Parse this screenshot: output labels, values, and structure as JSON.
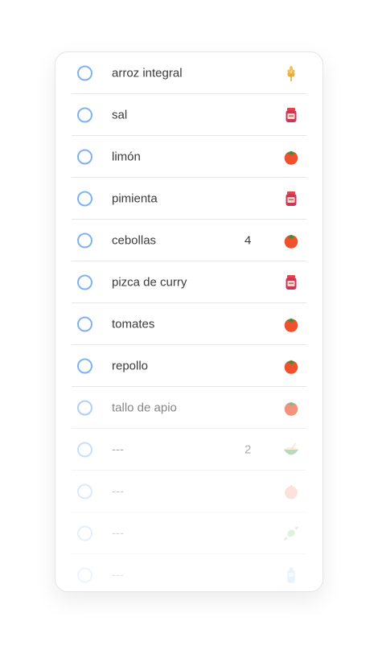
{
  "items": [
    {
      "label": "arroz integral",
      "qty": "",
      "icon": "grain-icon"
    },
    {
      "label": "sal",
      "qty": "",
      "icon": "jar-icon"
    },
    {
      "label": "limón",
      "qty": "",
      "icon": "tomato-icon"
    },
    {
      "label": "pimienta",
      "qty": "",
      "icon": "jar-icon"
    },
    {
      "label": "cebollas",
      "qty": "4",
      "icon": "tomato-icon"
    },
    {
      "label": "pizca de curry",
      "qty": "",
      "icon": "jar-icon"
    },
    {
      "label": "tomates",
      "qty": "",
      "icon": "tomato-icon"
    },
    {
      "label": "repollo",
      "qty": "",
      "icon": "tomato-icon"
    },
    {
      "label": "tallo de apio",
      "qty": "",
      "icon": "tomato-icon"
    },
    {
      "label": "---",
      "qty": "2",
      "icon": "bowl-icon"
    },
    {
      "label": "---",
      "qty": "",
      "icon": "peach-icon"
    },
    {
      "label": "---",
      "qty": "",
      "icon": "candy-icon"
    },
    {
      "label": "---",
      "qty": "",
      "icon": "bottle-icon"
    }
  ],
  "colors": {
    "checkbox": "#7fb2f3",
    "text": "#3a3a3a",
    "divider": "#e6e6e6"
  }
}
